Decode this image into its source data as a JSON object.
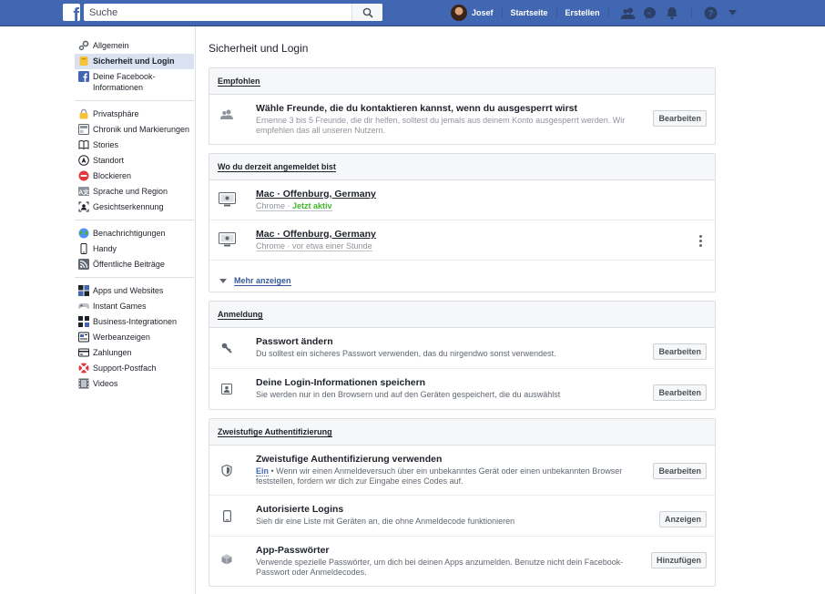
{
  "topbar": {
    "logo_letter": "f",
    "search_placeholder": "Suche",
    "user_name": "Josef",
    "links": [
      "Startseite",
      "Erstellen"
    ]
  },
  "sidebar": {
    "groups": [
      [
        {
          "label": "Allgemein",
          "icon": "gears-icon"
        },
        {
          "label": "Sicherheit und Login",
          "icon": "badge-icon",
          "active": true
        },
        {
          "label": "Deine Facebook-Informationen",
          "icon": "facebook-icon"
        }
      ],
      [
        {
          "label": "Privatsphäre",
          "icon": "lock-icon"
        },
        {
          "label": "Chronik und Markierungen",
          "icon": "timeline-icon"
        },
        {
          "label": "Stories",
          "icon": "book-icon"
        },
        {
          "label": "Standort",
          "icon": "location-icon"
        },
        {
          "label": "Blockieren",
          "icon": "block-icon"
        },
        {
          "label": "Sprache und Region",
          "icon": "language-icon"
        },
        {
          "label": "Gesichtserkennung",
          "icon": "face-icon"
        }
      ],
      [
        {
          "label": "Benachrichtigungen",
          "icon": "globe-icon"
        },
        {
          "label": "Handy",
          "icon": "phone-icon"
        },
        {
          "label": "Öffentliche Beiträge",
          "icon": "rss-icon"
        }
      ],
      [
        {
          "label": "Apps und Websites",
          "icon": "apps-icon"
        },
        {
          "label": "Instant Games",
          "icon": "gamepad-icon"
        },
        {
          "label": "Business-Integrationen",
          "icon": "business-icon"
        },
        {
          "label": "Werbeanzeigen",
          "icon": "ads-icon"
        },
        {
          "label": "Zahlungen",
          "icon": "payment-icon"
        },
        {
          "label": "Support-Postfach",
          "icon": "lifebuoy-icon"
        },
        {
          "label": "Videos",
          "icon": "film-icon"
        }
      ]
    ]
  },
  "main": {
    "title": "Sicherheit und Login",
    "recommended": {
      "header": "Empfohlen",
      "title": "Wähle Freunde, die du kontaktieren kannst, wenn du ausgesperrt wirst",
      "desc": "Ernenne 3 bis 5 Freunde, die dir helfen, solltest du jemals aus deinem Konto ausgesperrt werden. Wir empfehlen das all unseren Nutzern.",
      "button": "Bearbeiten"
    },
    "logged_in": {
      "header": "Wo du derzeit angemeldet bist",
      "sessions": [
        {
          "device": "Mac · Offenburg, Germany",
          "browser": "Chrome",
          "sep": " · ",
          "status": "Jetzt aktiv",
          "active": true
        },
        {
          "device": "Mac · Offenburg, Germany",
          "browser": "Chrome",
          "sep": " · ",
          "status": "vor etwa einer Stunde",
          "active": false
        }
      ],
      "more": "Mehr anzeigen"
    },
    "login": {
      "header": "Anmeldung",
      "rows": [
        {
          "title": "Passwort ändern",
          "desc": "Du solltest ein sicheres Passwort verwenden, das du nirgendwo sonst verwendest.",
          "button": "Bearbeiten"
        },
        {
          "title": "Deine Login-Informationen speichern",
          "desc": "Sie werden nur in den Browsern und auf den Geräten gespeichert, die du auswählst",
          "button": "Bearbeiten"
        }
      ]
    },
    "twofactor": {
      "header": "Zweistufige Authentifizierung",
      "rows": [
        {
          "title": "Zweistufige Authentifizierung verwenden",
          "status": "Ein",
          "desc": " • Wenn wir einen Anmeldeversuch über ein unbekanntes Gerät oder einen unbekannten Browser feststellen, fordern wir dich zur Eingabe eines Codes auf.",
          "button": "Bearbeiten"
        },
        {
          "title": "Autorisierte Logins",
          "desc": "Sieh dir eine Liste mit Geräten an, die ohne Anmeldecode funktionieren",
          "button": "Anzeigen"
        },
        {
          "title": "App-Passwörter",
          "desc": "Verwende spezielle Passwörter, um dich bei deinen Apps anzumelden. Benutze nicht dein Facebook-Passwort oder Anmeldecodes.",
          "button": "Hinzufügen"
        }
      ]
    }
  }
}
